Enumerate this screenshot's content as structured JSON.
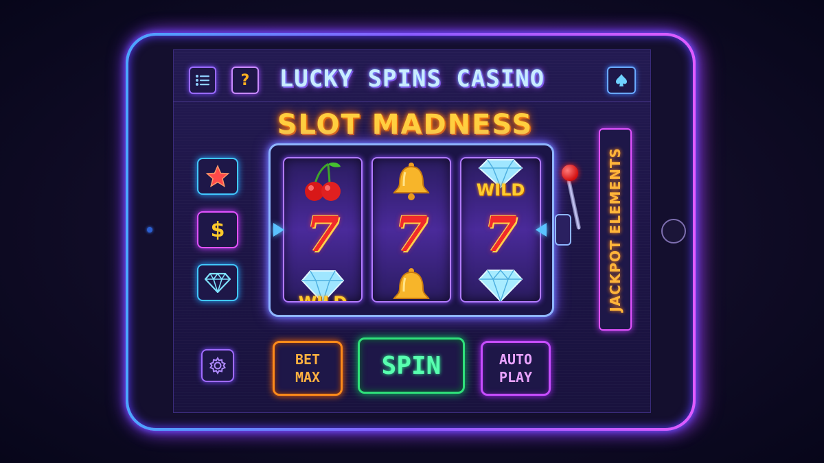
{
  "app": {
    "title": "LUCKY SPINS CASINO"
  },
  "game": {
    "title": "SLOT MADNESS"
  },
  "header": {
    "menu_icon": "list-menu-icon",
    "help_label": "?",
    "spade_icon": "spade-icon"
  },
  "side_buttons": {
    "star_icon": "star-icon",
    "dollar_label": "$",
    "diamond_icon": "diamond-icon",
    "settings_icon": "gear-icon"
  },
  "reels": [
    {
      "top": "cherry",
      "middle": "7",
      "bottom": "wild-diamond",
      "bottom_text": "WILD"
    },
    {
      "top": "bell",
      "middle": "7",
      "bottom": "bell"
    },
    {
      "top": "wild-diamond",
      "top_text": "WILD",
      "middle": "7",
      "bottom": "diamond"
    }
  ],
  "side_panel": {
    "label": "JACKPOT ELEMENTS"
  },
  "controls": {
    "bet_max": [
      "BET",
      "MAX"
    ],
    "spin": "SPIN",
    "auto_play": [
      "AUTO",
      "PLAY"
    ]
  },
  "colors": {
    "frame_blue": "#4aa7ff",
    "frame_pink": "#e05bff",
    "title_gold": "#ffcf3f",
    "spin_green": "#2fe07a",
    "bet_orange": "#ff8a1a",
    "auto_purple": "#c64dff"
  }
}
